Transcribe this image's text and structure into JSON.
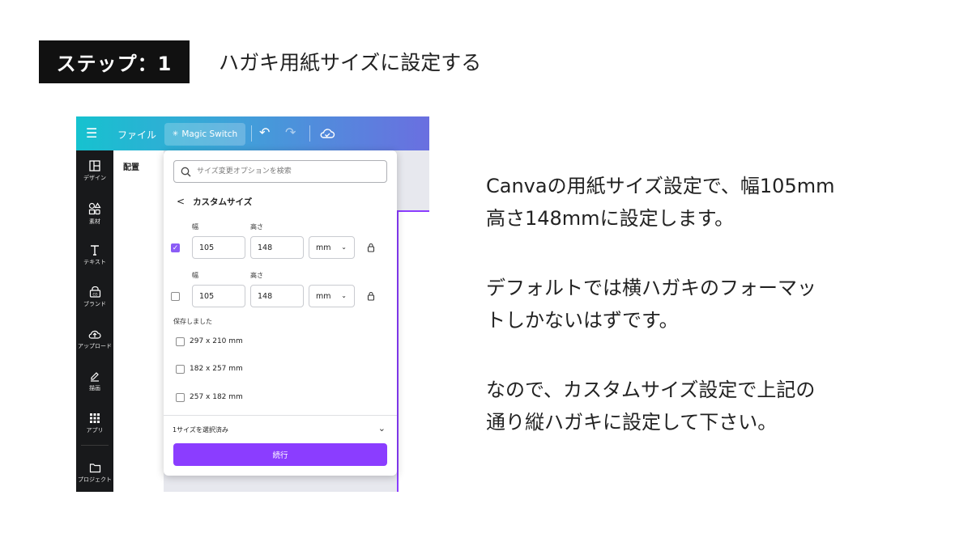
{
  "header": {
    "step_badge": "ステップ：1",
    "title": "ハガキ用紙サイズに設定する"
  },
  "app": {
    "topbar": {
      "file_menu": "ファイル",
      "magic_switch": "Magic Switch"
    },
    "sidebar": {
      "items": [
        {
          "label": "デザイン",
          "icon": "layout-icon"
        },
        {
          "label": "素材",
          "icon": "shapes-icon"
        },
        {
          "label": "テキスト",
          "icon": "text-icon"
        },
        {
          "label": "ブランド",
          "icon": "brand-icon"
        },
        {
          "label": "アップロード",
          "icon": "upload-icon"
        },
        {
          "label": "描画",
          "icon": "draw-icon"
        },
        {
          "label": "アプリ",
          "icon": "apps-icon"
        },
        {
          "label": "プロジェクト",
          "icon": "folder-icon"
        }
      ]
    },
    "panel_title": "配置",
    "resize": {
      "search_placeholder": "サイズ変更オプションを検索",
      "back_label": "カスタムサイズ",
      "rows": [
        {
          "width_label": "幅",
          "height_label": "高さ",
          "width": "105",
          "height": "148",
          "unit": "mm",
          "checked": true
        },
        {
          "width_label": "幅",
          "height_label": "高さ",
          "width": "105",
          "height": "148",
          "unit": "mm",
          "checked": false
        }
      ],
      "saved_title": "保存しました",
      "saved": [
        "297 x 210 mm",
        "182 x 257 mm",
        "257 x 182 mm"
      ],
      "selection_count": "1サイズを選択済み",
      "continue": "続行"
    },
    "colors": {
      "accent": "#8b3dff",
      "checkbox": "#8b5cf6",
      "sidebar": "#18191b"
    }
  },
  "explanation": [
    "Canvaの用紙サイズ設定で、幅105mm",
    "高さ148mmに設定します。",
    "デフォルトでは横ハガキのフォーマッ",
    "トしかないはずです。",
    "なので、カスタムサイズ設定で上記の",
    "通り縦ハガキに設定して下さい。"
  ]
}
